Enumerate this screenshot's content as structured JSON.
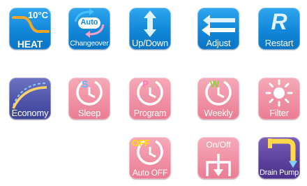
{
  "tiles": {
    "heat": {
      "label": "HEAT",
      "temp": "10°C"
    },
    "changeover": {
      "label": "Changeover",
      "badge": "Auto"
    },
    "updown": {
      "label": "Up/Down"
    },
    "adjust": {
      "label": "Adjust"
    },
    "restart": {
      "label": "Restart",
      "glyph": "R"
    },
    "economy": {
      "label": "Economy"
    },
    "sleep": {
      "label": "Sleep",
      "letter": "S"
    },
    "program": {
      "label": "Program",
      "letter": "P"
    },
    "weekly": {
      "label": "Weekly",
      "letter": "W"
    },
    "filter": {
      "label": "Filter"
    },
    "autooff": {
      "label": "Auto OFF",
      "badge": "OFF"
    },
    "onoff": {
      "label": "On/Off"
    },
    "drainpump": {
      "label": "Drain Pump"
    }
  },
  "colors": {
    "blue": "#1287d8",
    "pink": "#ef8ea2",
    "indigo": "#4b52a8",
    "purple": "#5a3f9c",
    "orange": "#f6a623",
    "green": "#8fd03a",
    "yellow": "#ffe000"
  },
  "icons": [
    "heat-curve-icon",
    "auto-changeover-icon",
    "up-down-arrow-icon",
    "adjust-arrows-icon",
    "restart-icon",
    "economy-curve-icon",
    "sleep-timer-icon",
    "program-timer-icon",
    "weekly-timer-icon",
    "filter-sun-icon",
    "auto-off-timer-icon",
    "on-off-icon",
    "drain-pump-icon"
  ]
}
